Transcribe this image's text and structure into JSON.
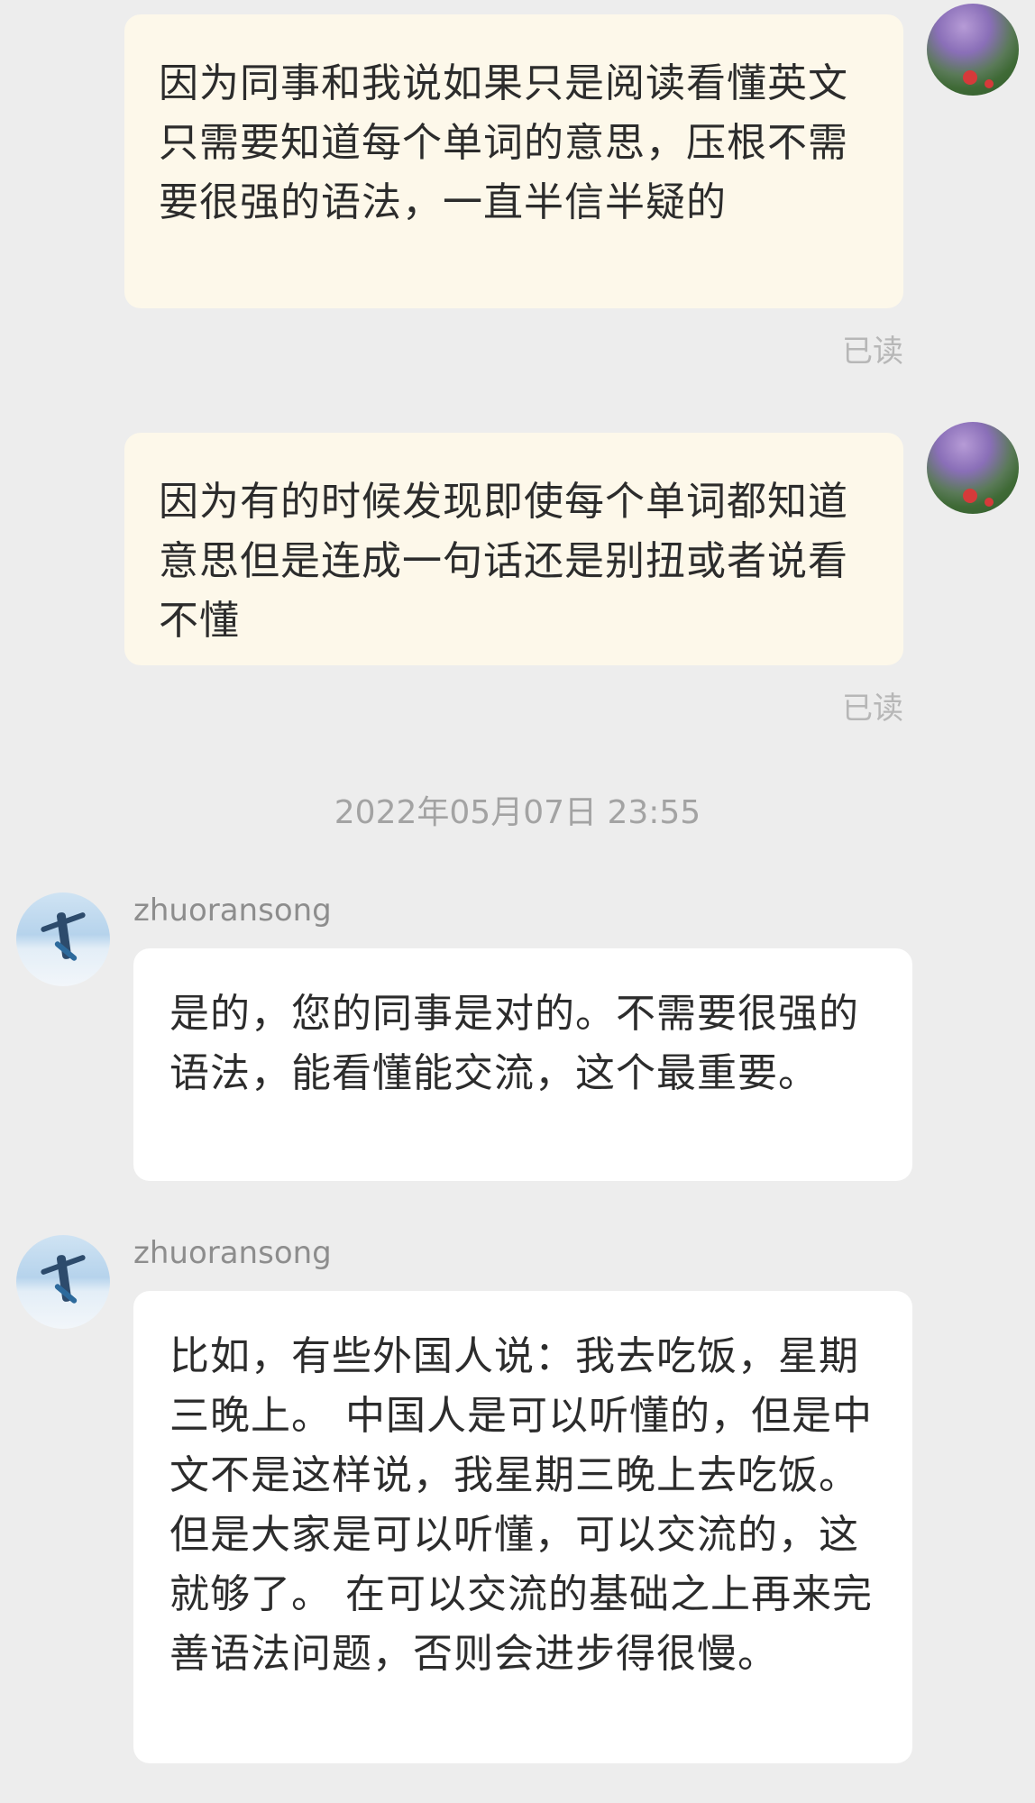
{
  "messages": [
    {
      "direction": "out",
      "text": "因为同事和我说如果只是阅读看懂英文只需要知道每个单词的意思，压根不需要很强的语法，一直半信半疑的",
      "status": "已读"
    },
    {
      "direction": "out",
      "text": "因为有的时候发现即使每个单词都知道意思但是连成一句话还是别扭或者说看不懂",
      "status": "已读"
    },
    {
      "direction": "timestamp",
      "text": "2022年05月07日 23:55"
    },
    {
      "direction": "in",
      "sender": "zhuoransong",
      "text": "是的，您的同事是对的。不需要很强的语法，能看懂能交流，这个最重要。"
    },
    {
      "direction": "in",
      "sender": "zhuoransong",
      "text": "比如，有些外国人说：我去吃饭，星期三晚上。 中国人是可以听懂的，但是中文不是这样说，我星期三晚上去吃饭。 但是大家是可以听懂，可以交流的，这就够了。 在可以交流的基础之上再来完善语法问题，否则会进步得很慢。"
    }
  ]
}
